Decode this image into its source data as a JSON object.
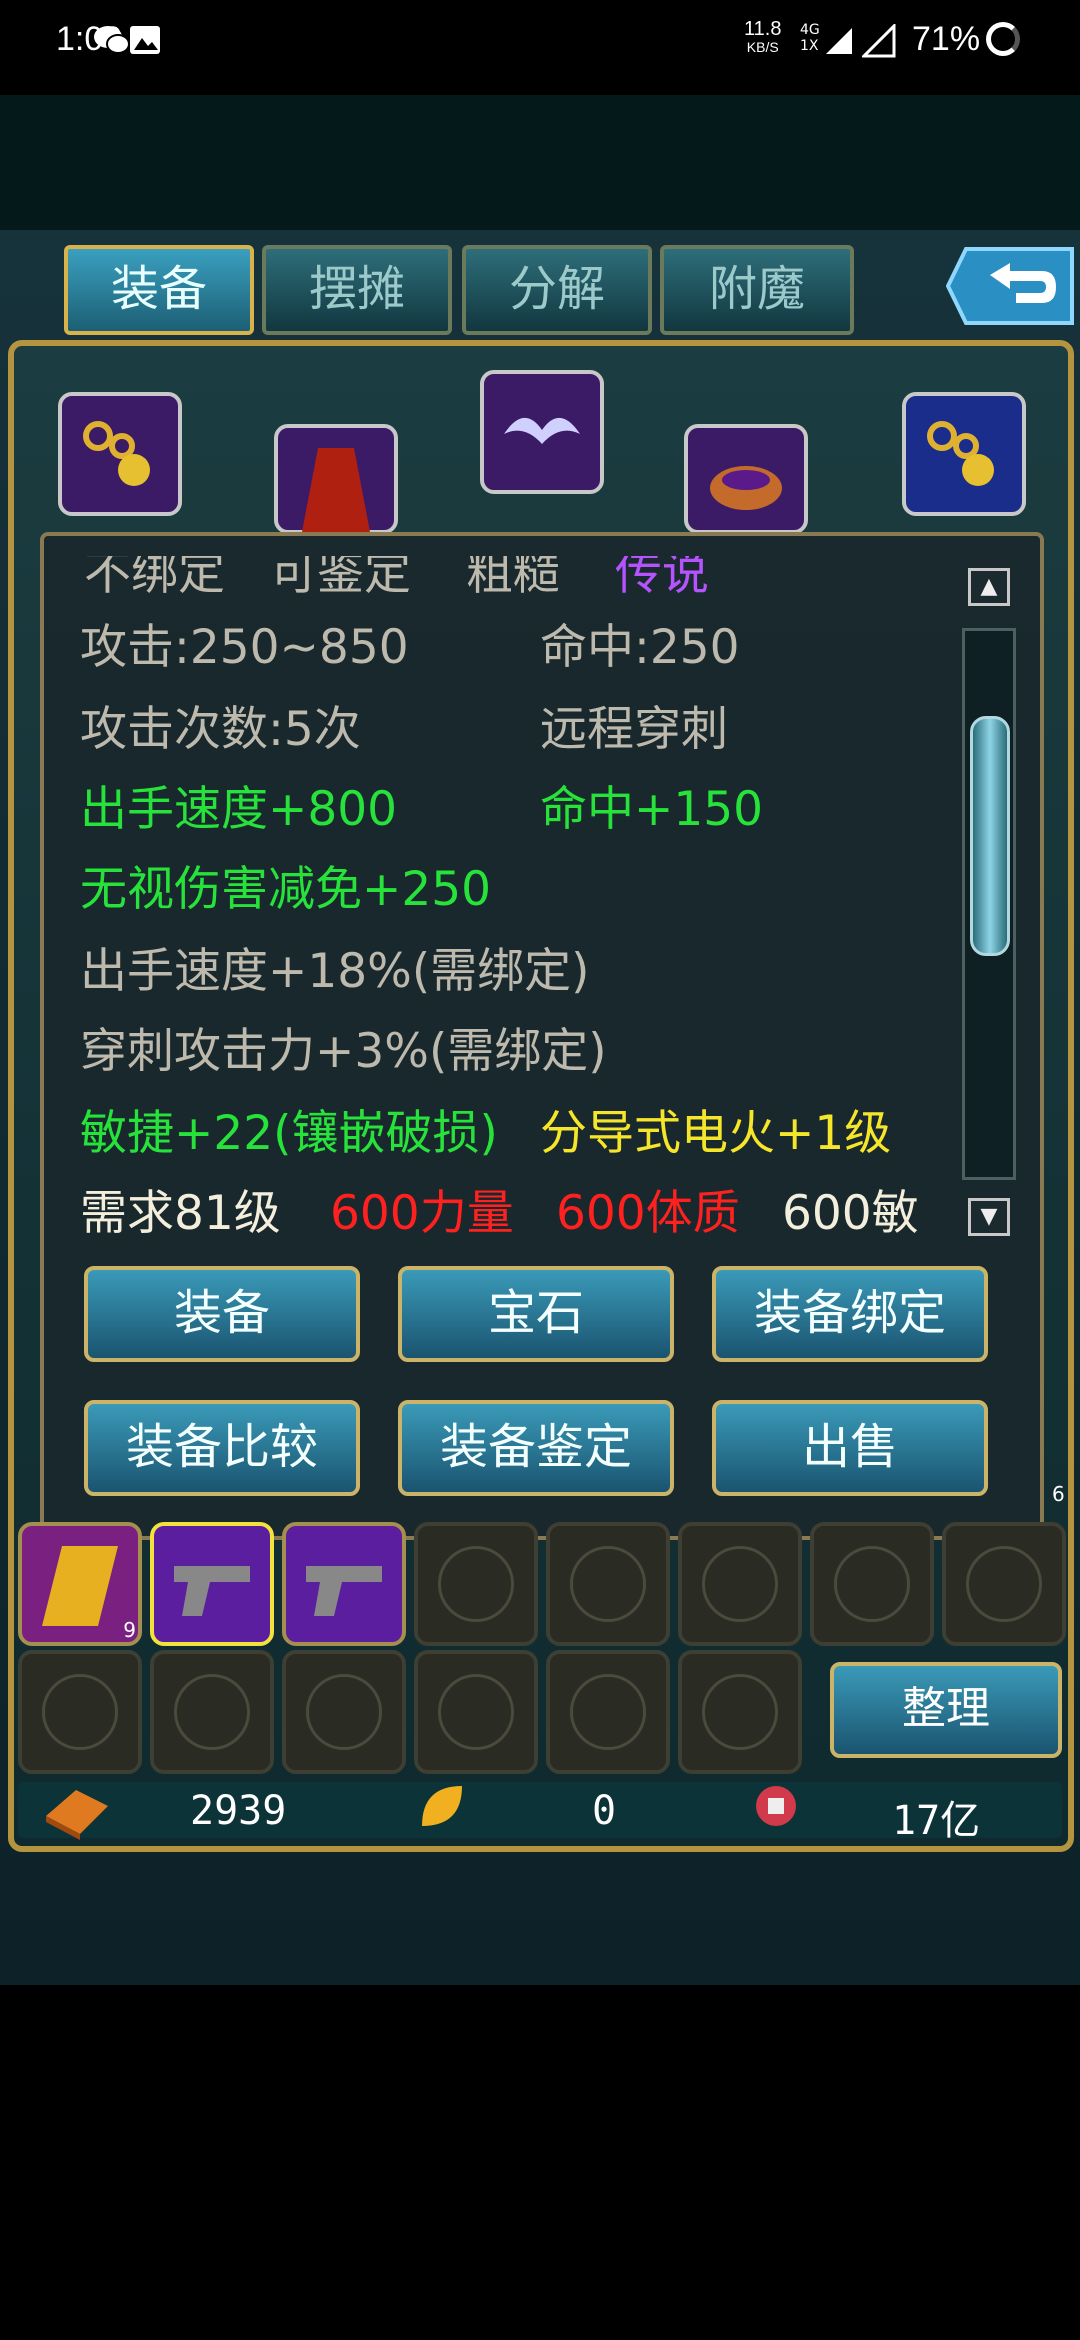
{
  "status_bar": {
    "time": "1:00",
    "net_speed": "11.8",
    "net_unit": "KB/S",
    "net_type_top": "4G",
    "net_type_bottom": "1X",
    "battery": "71%"
  },
  "tabs": [
    {
      "label": "装备",
      "active": true
    },
    {
      "label": "摆摊",
      "active": false
    },
    {
      "label": "分解",
      "active": false
    },
    {
      "label": "附魔",
      "active": false
    }
  ],
  "tooltip": {
    "cut_line": {
      "a": "不绑定",
      "b": "可鉴定",
      "c": "粗糙",
      "d": "传说"
    },
    "lines": [
      {
        "a": "攻击:250~850",
        "b": "命中:250"
      },
      {
        "a": "攻击次数:5次",
        "b": "远程穿刺"
      },
      {
        "a": "出手速度+800",
        "b": "命中+150"
      },
      {
        "a": "无视伤害减免+250"
      },
      {
        "a": "出手速度+18%(需绑定)"
      },
      {
        "a": "穿刺攻击力+3%(需绑定)"
      },
      {
        "a": "敏捷+22(镶嵌破损)",
        "b": "分导式电火+1级"
      },
      {
        "a": "需求81级",
        "b": "600力量",
        "c": "600体质",
        "d": "600敏"
      }
    ]
  },
  "buttons": {
    "equip": "装备",
    "gem": "宝石",
    "bind": "装备绑定",
    "compare": "装备比较",
    "identify": "装备鉴定",
    "sell": "出售",
    "sort": "整理"
  },
  "inventory": {
    "item_counts": {
      "card": "9",
      "side": "6"
    }
  },
  "currency": {
    "gold": "2939",
    "leaf": "0",
    "coin": "17亿"
  }
}
